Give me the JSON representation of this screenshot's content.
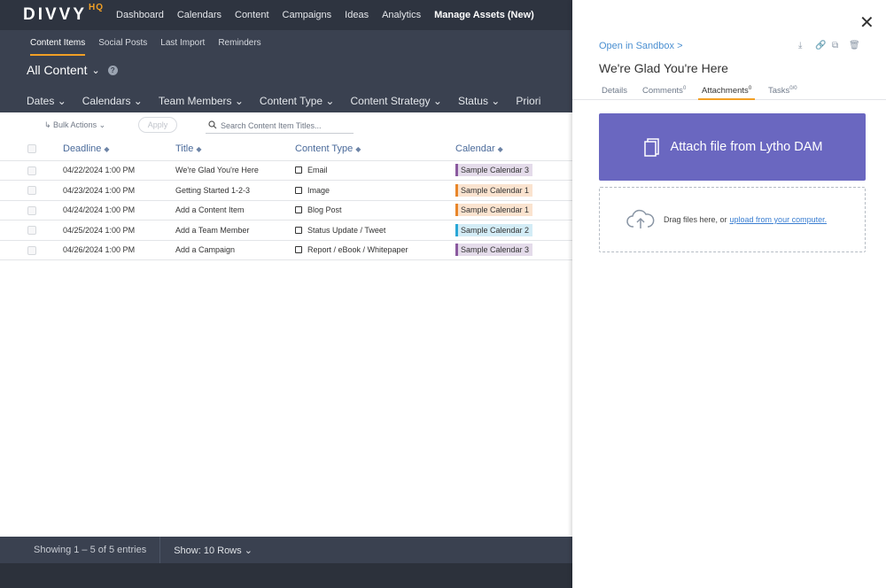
{
  "brand": {
    "name": "DIVVY",
    "suffix": "HQ"
  },
  "topnav": [
    "Dashboard",
    "Calendars",
    "Content",
    "Campaigns",
    "Ideas",
    "Analytics",
    "Manage Assets (New)"
  ],
  "subnav": [
    "Content Items",
    "Social Posts",
    "Last Import",
    "Reminders"
  ],
  "page_title": "All Content",
  "help_icon": "?",
  "filters": [
    "Dates",
    "Calendars",
    "Team Members",
    "Content Type",
    "Content Strategy",
    "Status",
    "Priori"
  ],
  "toolbar": {
    "bulk_actions": "Bulk Actions",
    "apply": "Apply",
    "search_placeholder": "Search Content Item Titles..."
  },
  "table": {
    "headers": [
      "Deadline",
      "Title",
      "Content Type",
      "Calendar"
    ],
    "rows": [
      {
        "deadline": "04/22/2024 1:00 PM",
        "title": "We're Glad You're Here",
        "type": "Email",
        "calendar": "Sample Calendar 3",
        "cal_color": "#8b5a9f",
        "cal_bg": "#e4dbea"
      },
      {
        "deadline": "04/23/2024 1:00 PM",
        "title": "Getting Started 1-2-3",
        "type": "Image",
        "calendar": "Sample Calendar 1",
        "cal_color": "#e8862a",
        "cal_bg": "#fae3cf"
      },
      {
        "deadline": "04/24/2024 1:00 PM",
        "title": "Add a Content Item",
        "type": "Blog Post",
        "calendar": "Sample Calendar 1",
        "cal_color": "#e8862a",
        "cal_bg": "#fae3cf"
      },
      {
        "deadline": "04/25/2024 1:00 PM",
        "title": "Add a Team Member",
        "type": "Status Update / Tweet",
        "calendar": "Sample Calendar 2",
        "cal_color": "#2aa7d6",
        "cal_bg": "#d3ecf6"
      },
      {
        "deadline": "04/26/2024 1:00 PM",
        "title": "Add a Campaign",
        "type": "Report / eBook / Whitepaper",
        "calendar": "Sample Calendar 3",
        "cal_color": "#8b5a9f",
        "cal_bg": "#e4dbea"
      }
    ]
  },
  "footer": {
    "showing": "Showing 1 – 5 of 5 entries",
    "rows": "Show: 10 Rows"
  },
  "panel": {
    "sandbox": "Open in Sandbox >",
    "title": "We're Glad You're Here",
    "tabs": [
      {
        "label": "Details",
        "count": ""
      },
      {
        "label": "Comments",
        "count": "0"
      },
      {
        "label": "Attachments",
        "count": "0"
      },
      {
        "label": "Tasks",
        "count": "0/0"
      }
    ],
    "attach_label": "Attach file from Lytho DAM",
    "drop_text": "Drag files here, or",
    "drop_link": "upload from your computer."
  },
  "colors": {
    "accent": "#f2a025",
    "nav": "#2e3440",
    "attach": "#6a67c0",
    "link": "#3a7ed1"
  }
}
